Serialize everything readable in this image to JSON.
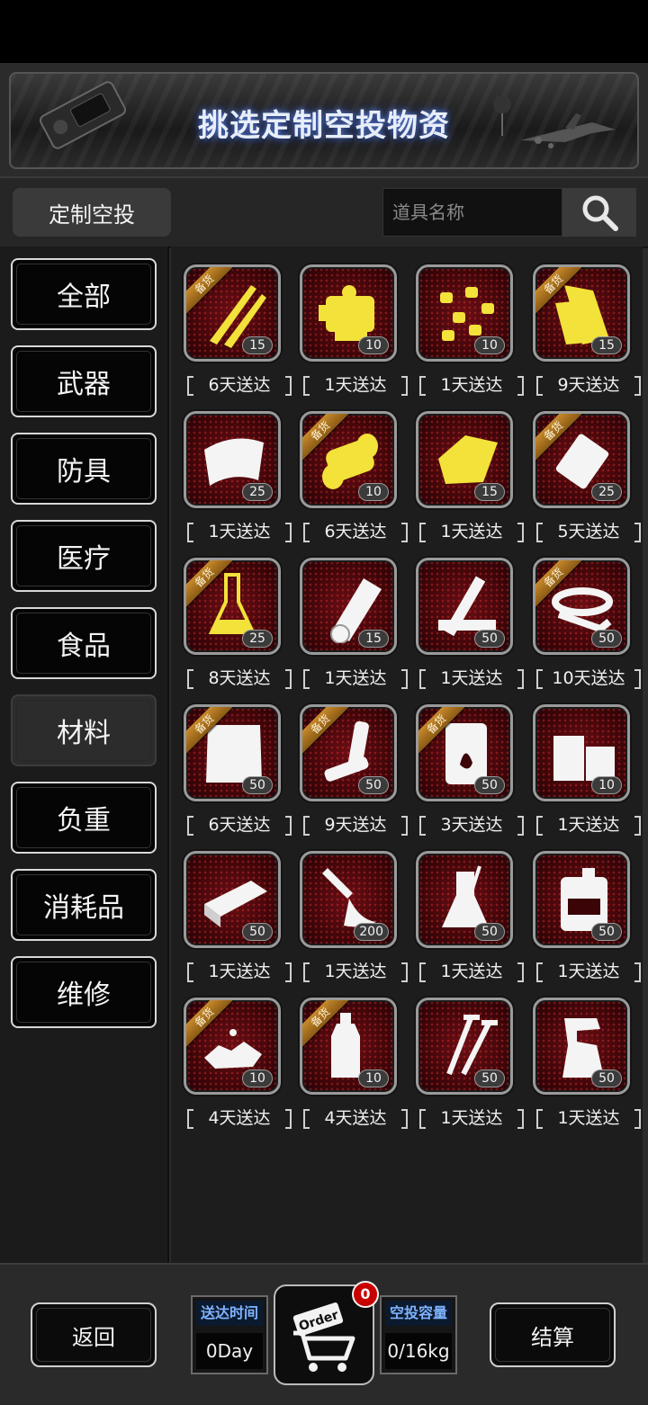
{
  "banner": {
    "title": "挑选定制空投物资"
  },
  "header": {
    "custom_tab": "定制空投",
    "search_placeholder": "道具名称"
  },
  "categories": [
    "全部",
    "武器",
    "防具",
    "医疗",
    "食品",
    "材料",
    "负重",
    "消耗品",
    "维修"
  ],
  "active_category": "材料",
  "ribbon_label": "备货",
  "items": [
    {
      "icon": "ribbon-strips-icon",
      "qty": "15",
      "delivery": "6天送达",
      "stocked": true
    },
    {
      "icon": "engine-parts-icon",
      "qty": "10",
      "delivery": "1天送达",
      "stocked": false
    },
    {
      "icon": "nuggets-icon",
      "qty": "10",
      "delivery": "1天送达",
      "stocked": false
    },
    {
      "icon": "leather-icon",
      "qty": "15",
      "delivery": "9天送达",
      "stocked": true
    },
    {
      "icon": "cloth-icon",
      "qty": "25",
      "delivery": "1天送达",
      "stocked": false
    },
    {
      "icon": "spool-icon",
      "qty": "10",
      "delivery": "6天送达",
      "stocked": true
    },
    {
      "icon": "folded-cloth-icon",
      "qty": "15",
      "delivery": "1天送达",
      "stocked": false
    },
    {
      "icon": "packet-icon",
      "qty": "25",
      "delivery": "5天送达",
      "stocked": true
    },
    {
      "icon": "flask-icon",
      "qty": "25",
      "delivery": "8天送达",
      "stocked": true
    },
    {
      "icon": "paper-roll-icon",
      "qty": "15",
      "delivery": "1天送达",
      "stocked": false
    },
    {
      "icon": "wood-planks-icon",
      "qty": "50",
      "delivery": "1天送达",
      "stocked": false
    },
    {
      "icon": "tape-icon",
      "qty": "50",
      "delivery": "10天送达",
      "stocked": true
    },
    {
      "icon": "towel-icon",
      "qty": "50",
      "delivery": "6天送达",
      "stocked": true
    },
    {
      "icon": "battery-icon",
      "qty": "50",
      "delivery": "9天送达",
      "stocked": true
    },
    {
      "icon": "fuel-barrel-icon",
      "qty": "50",
      "delivery": "3天送达",
      "stocked": true
    },
    {
      "icon": "lumber-icon",
      "qty": "10",
      "delivery": "1天送达",
      "stocked": false
    },
    {
      "icon": "brick-icon",
      "qty": "50",
      "delivery": "1天送达",
      "stocked": false
    },
    {
      "icon": "glue-tube-icon",
      "qty": "200",
      "delivery": "1天送达",
      "stocked": false
    },
    {
      "icon": "beaker-icon",
      "qty": "50",
      "delivery": "1天送达",
      "stocked": false
    },
    {
      "icon": "jerrycan-icon",
      "qty": "50",
      "delivery": "1天送达",
      "stocked": false
    },
    {
      "icon": "rubble-icon",
      "qty": "10",
      "delivery": "4天送达",
      "stocked": true
    },
    {
      "icon": "bottle-icon",
      "qty": "10",
      "delivery": "4天送达",
      "stocked": true
    },
    {
      "icon": "nails-icon",
      "qty": "50",
      "delivery": "1天送达",
      "stocked": false
    },
    {
      "icon": "spray-bottle-icon",
      "qty": "50",
      "delivery": "1天送达",
      "stocked": false
    }
  ],
  "footer": {
    "back_label": "返回",
    "delivery_time_label": "送达时间",
    "delivery_time_value": "0Day",
    "cart_tag": "Order",
    "cart_count": "0",
    "capacity_label": "空投容量",
    "capacity_value": "0/16kg",
    "checkout_label": "结算"
  },
  "colors": {
    "tile_red": "#5a0a10",
    "highlight_yellow": "#f2e23a",
    "ribbon_gold": "#c88a2c",
    "stat_label_blue": "#7fb3ff",
    "badge_red": "#c80000"
  }
}
